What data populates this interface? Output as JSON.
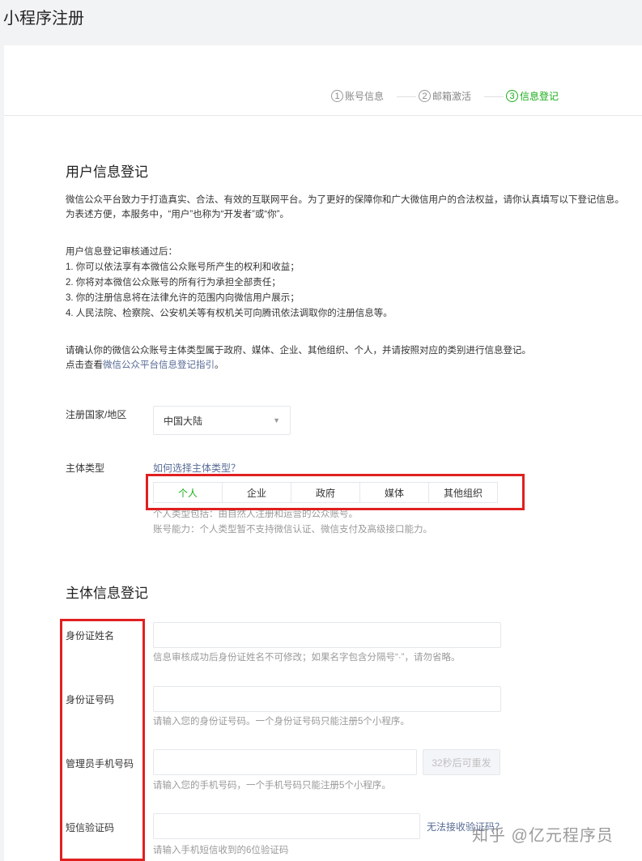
{
  "page": {
    "title": "小程序注册"
  },
  "steps": [
    {
      "num": "1",
      "label": "账号信息"
    },
    {
      "num": "2",
      "label": "邮箱激活"
    },
    {
      "num": "3",
      "label": "信息登记"
    }
  ],
  "user_info": {
    "title": "用户信息登记",
    "intro_line1": "微信公众平台致力于打造真实、合法、有效的互联网平台。为了更好的保障你和广大微信用户的合法权益，请你认真填写以下登记信息。",
    "intro_line2": "为表述方便，本服务中，“用户”也称为“开发者”或“你”。",
    "review_title": "用户信息登记审核通过后：",
    "review_items": [
      "1. 你可以依法享有本微信公众账号所产生的权利和收益；",
      "2. 你将对本微信公众账号的所有行为承担全部责任；",
      "3. 你的注册信息将在法律允许的范围内向微信用户展示；",
      "4. 人民法院、检察院、公安机关等有权机关可向腾讯依法调取你的注册信息等。"
    ],
    "confirm_line": "请确认你的微信公众账号主体类型属于政府、媒体、企业、其他组织、个人，并请按照对应的类别进行信息登记。",
    "guide_prefix": "点击查看",
    "guide_link": "微信公众平台信息登记指引",
    "guide_suffix": "。"
  },
  "country": {
    "label": "注册国家/地区",
    "value": "中国大陆"
  },
  "subject_type": {
    "label": "主体类型",
    "help_link": "如何选择主体类型？",
    "options": [
      "个人",
      "企业",
      "政府",
      "媒体",
      "其他组织"
    ],
    "selected": "个人",
    "hint1": "个人类型包括：由自然人注册和运营的公众账号。",
    "hint2": "账号能力：个人类型暂不支持微信认证、微信支付及高级接口能力。"
  },
  "subject_info": {
    "title": "主体信息登记",
    "id_name": {
      "label": "身份证姓名",
      "value": "",
      "hint": "信息审核成功后身份证姓名不可修改；如果名字包含分隔号“·”，请勿省略。"
    },
    "id_number": {
      "label": "身份证号码",
      "value": "",
      "hint": "请输入您的身份证号码。一个身份证号码只能注册5个小程序。"
    },
    "admin_phone": {
      "label": "管理员手机号码",
      "value": "",
      "resend": "32秒后可重发",
      "hint": "请输入您的手机号码，一个手机号码只能注册5个小程序。"
    },
    "sms_code": {
      "label": "短信验证码",
      "value": "",
      "link": "无法接收验证码？",
      "hint": "请输入手机短信收到的6位验证码"
    }
  },
  "watermark": "知乎 @亿元程序员",
  "colors": {
    "accent": "#1aad19",
    "link": "#576b95",
    "highlight": "#e02020"
  }
}
